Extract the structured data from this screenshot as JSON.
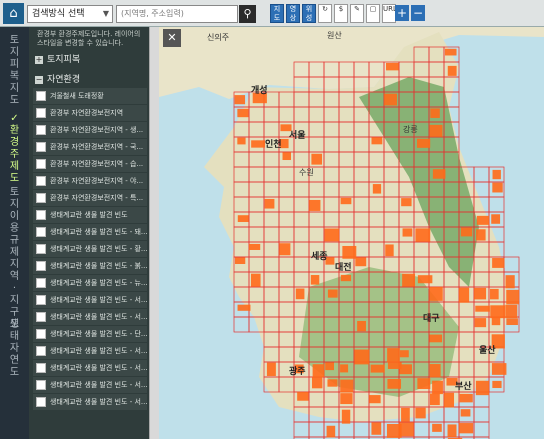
{
  "topbar": {
    "home_icon": "home-icon",
    "search_type": "검색방식 선택",
    "search_placeholder": "(지역명, 주소입력)",
    "search_icon": "search-icon",
    "tools": [
      "지도",
      "영상",
      "위성",
      "↻",
      "$",
      "✎",
      "▢",
      "URL"
    ],
    "zoom_in": "+",
    "zoom_out": "−"
  },
  "sidebar": {
    "vertical_tabs": [
      {
        "label": "토지피복지도",
        "active": false
      },
      {
        "label": "환경주제도",
        "active": true
      },
      {
        "label": "토지이용규제지역·지구도",
        "active": false
      },
      {
        "label": "생태자연도",
        "active": false
      }
    ],
    "description": "환경부 환경주제도입니다. 레이어의 스타일을 변경할 수 있습니다.",
    "categories": [
      {
        "label": "토지피복",
        "expanded": false
      },
      {
        "label": "자연환경",
        "expanded": true
      }
    ],
    "items": [
      "겨울철새 도래정황",
      "환경부 자연환경보전지역",
      "환경부 자연환경보전지역 - 생...",
      "환경부 자연환경보전지역 - 국...",
      "환경부 자연환경보전지역 - 습...",
      "환경부 자연환경보전지역 - 야...",
      "환경부 자연환경보전지역 - 특...",
      "생태계교란 생물 발견 빈도",
      "생태계교란 생물 발견 빈도 - 돼...",
      "생태계교란 생물 발견 빈도 - 황...",
      "생태계교란 생물 발견 빈도 - 붉...",
      "생태계교란 생물 발견 빈도 - 뉴...",
      "생태계교란 생물 발견 빈도 - 서...",
      "생태계교란 생물 발견 빈도 - 서...",
      "생태계교란 생물 발견 빈도 - 단...",
      "생태계교란 생물 발견 빈도 - 서...",
      "생태계교란 생물 발견 빈도 - 서...",
      "생태계교란 생물 발견 빈도 - 서...",
      "생태계교란 생물 발견 빈도 - 서..."
    ]
  },
  "map": {
    "close_icon": "close-icon",
    "labels": {
      "sinuiju": "신의주",
      "gaeseong": "개성",
      "seoul": "서울",
      "incheon": "인천",
      "suwon": "수원",
      "sejong": "세종",
      "daejeon": "대전",
      "gwangju": "광주",
      "ulsan": "울산",
      "busan": "부산",
      "daegu": "대구",
      "gangneung": "강릉",
      "wonsan": "원산"
    },
    "colors": {
      "hotspot": "#ff6a1a",
      "grid": "#e63030",
      "land": "#e9e4c9",
      "sea": "#bfe0ea",
      "forest": "#3e8f3a"
    }
  }
}
